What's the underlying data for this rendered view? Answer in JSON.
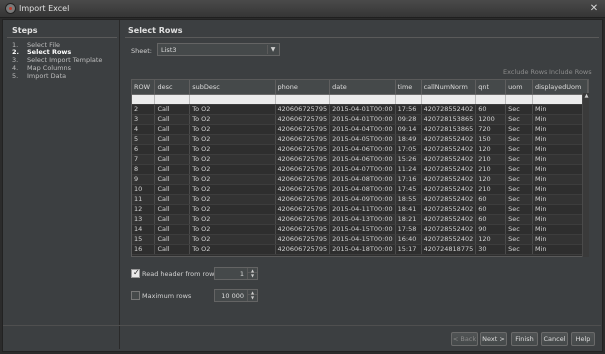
{
  "window": {
    "title": "Import Excel",
    "close_glyph": "✕"
  },
  "steps": {
    "title": "Steps",
    "items": [
      {
        "num": "1.",
        "label": "Select File"
      },
      {
        "num": "2.",
        "label": "Select Rows"
      },
      {
        "num": "3.",
        "label": "Select Import Template"
      },
      {
        "num": "4.",
        "label": "Map Columns"
      },
      {
        "num": "5.",
        "label": "Import Data"
      }
    ],
    "active_index": 1
  },
  "main": {
    "title": "Select Rows",
    "sheet_label": "Sheet:",
    "sheet_value": "List3",
    "exclude_rows": "Exclude Rows",
    "include_rows": "Include Rows"
  },
  "table": {
    "columns": [
      "ROW",
      "desc",
      "subDesc",
      "phone",
      "date",
      "time",
      "callNumNorm",
      "qnt",
      "uom",
      "displayedUom"
    ],
    "rows": [
      [
        "2",
        "Call",
        "To O2",
        "420606725795",
        "2015-04-01T00:00",
        "17:56",
        "420728552402",
        "60",
        "Sec",
        "Min"
      ],
      [
        "3",
        "Call",
        "To O2",
        "420606725795",
        "2015-04-01T00:00",
        "09:28",
        "420728153865",
        "1200",
        "Sec",
        "Min"
      ],
      [
        "4",
        "Call",
        "To O2",
        "420606725795",
        "2015-04-04T00:00",
        "09:14",
        "420728153865",
        "720",
        "Sec",
        "Min"
      ],
      [
        "5",
        "Call",
        "To O2",
        "420606725795",
        "2015-04-05T00:00",
        "18:49",
        "420728552402",
        "150",
        "Sec",
        "Min"
      ],
      [
        "6",
        "Call",
        "To O2",
        "420606725795",
        "2015-04-06T00:00",
        "17:05",
        "420728552402",
        "120",
        "Sec",
        "Min"
      ],
      [
        "7",
        "Call",
        "To O2",
        "420606725795",
        "2015-04-06T00:00",
        "15:26",
        "420728552402",
        "210",
        "Sec",
        "Min"
      ],
      [
        "8",
        "Call",
        "To O2",
        "420606725795",
        "2015-04-07T00:00",
        "11:24",
        "420728552402",
        "210",
        "Sec",
        "Min"
      ],
      [
        "9",
        "Call",
        "To O2",
        "420606725795",
        "2015-04-08T00:00",
        "17:16",
        "420728552402",
        "120",
        "Sec",
        "Min"
      ],
      [
        "10",
        "Call",
        "To O2",
        "420606725795",
        "2015-04-08T00:00",
        "17:45",
        "420728552402",
        "210",
        "Sec",
        "Min"
      ],
      [
        "11",
        "Call",
        "To O2",
        "420606725795",
        "2015-04-09T00:00",
        "18:55",
        "420728552402",
        "60",
        "Sec",
        "Min"
      ],
      [
        "12",
        "Call",
        "To O2",
        "420606725795",
        "2015-04-11T00:00",
        "18:41",
        "420728552402",
        "60",
        "Sec",
        "Min"
      ],
      [
        "13",
        "Call",
        "To O2",
        "420606725795",
        "2015-04-13T00:00",
        "18:21",
        "420728552402",
        "60",
        "Sec",
        "Min"
      ],
      [
        "14",
        "Call",
        "To O2",
        "420606725795",
        "2015-04-15T00:00",
        "17:58",
        "420728552402",
        "90",
        "Sec",
        "Min"
      ],
      [
        "15",
        "Call",
        "To O2",
        "420606725795",
        "2015-04-15T00:00",
        "16:40",
        "420728552402",
        "120",
        "Sec",
        "Min"
      ],
      [
        "16",
        "Call",
        "To O2",
        "420606725795",
        "2015-04-18T00:00",
        "15:17",
        "420724818775",
        "30",
        "Sec",
        "Min"
      ]
    ]
  },
  "options": {
    "read_header_label": "Read header from row",
    "read_header_checked": true,
    "read_header_value": "1",
    "max_rows_label": "Maximum rows",
    "max_rows_checked": false,
    "max_rows_value": "10 000"
  },
  "footer": {
    "back": "< Back",
    "next": "Next >",
    "finish": "Finish",
    "cancel": "Cancel",
    "help": "Help"
  }
}
